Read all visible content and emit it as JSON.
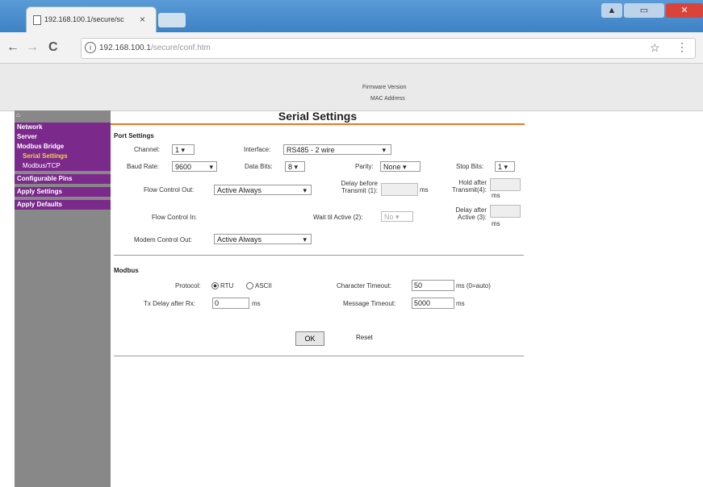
{
  "browser": {
    "tab_title": "192.168.100.1/secure/sc",
    "tab_close": "×",
    "url_host": "192.168.100.1",
    "url_path": "/secure/conf.htm",
    "back": "←",
    "forward": "→",
    "reload": "C",
    "info": "i",
    "star": "☆",
    "menu": "⋮"
  },
  "window_controls": {
    "minimize": "▲",
    "maximize": "▭",
    "close": "✕"
  },
  "header": {
    "firmware_label": "Firmware Version",
    "mac_label": "MAC Address"
  },
  "sidebar": {
    "items": [
      {
        "label": "Network",
        "kind": "cat"
      },
      {
        "label": "Server",
        "kind": "cat"
      },
      {
        "label": "Modbus Bridge",
        "kind": "cat"
      },
      {
        "label": "Serial Settings",
        "kind": "active"
      },
      {
        "label": "Modbus/TCP",
        "kind": "sub"
      },
      {
        "label": "Configurable Pins",
        "kind": "cat"
      },
      {
        "label": "Apply Settings",
        "kind": "cat"
      },
      {
        "label": "Apply Defaults",
        "kind": "cat"
      }
    ]
  },
  "main": {
    "title": "Serial Settings",
    "port": {
      "section": "Port Settings",
      "channel_label": "Channel:",
      "channel_value": "1 ▾",
      "interface_label": "Interface:",
      "interface_value": "RS485 - 2 wire",
      "baud_label": "Baud Rate:",
      "baud_value": "9600",
      "databits_label": "Data Bits:",
      "databits_value": "8 ▾",
      "parity_label": "Parity:",
      "parity_value": "None ▾",
      "stopbits_label": "Stop Bits:",
      "stopbits_value": "1 ▾",
      "flowout_label": "Flow Control Out:",
      "flowout_value": "Active Always",
      "delay_label_1": "Delay before",
      "delay_label_2": "Transmit (1):",
      "delay_unit": "ms",
      "hold_label_1": "Hold after",
      "hold_label_2": "Transmit(4):",
      "hold_unit": "ms",
      "flowin_label": "Flow Control In:",
      "wait_label": "Wait til Active (2):",
      "wait_value": "No ▾",
      "delayafter_label_1": "Delay after",
      "delayafter_label_2": "Active (3):",
      "delayafter_unit": "ms",
      "modem_label": "Modem Control Out:",
      "modem_value": "Active Always"
    },
    "modbus": {
      "section": "Modbus",
      "protocol_label": "Protocol:",
      "protocol_rtu": "RTU",
      "protocol_ascii": "ASCII",
      "char_timeout_label": "Character Timeout:",
      "char_timeout_value": "50",
      "char_timeout_unit": "ms (0=auto)",
      "txdelay_label": "Tx Delay after Rx:",
      "txdelay_value": "0",
      "txdelay_unit": "ms",
      "msg_timeout_label": "Message Timeout:",
      "msg_timeout_value": "5000",
      "msg_timeout_unit": "ms"
    },
    "ok_label": "OK",
    "reset_label": "Reset"
  }
}
